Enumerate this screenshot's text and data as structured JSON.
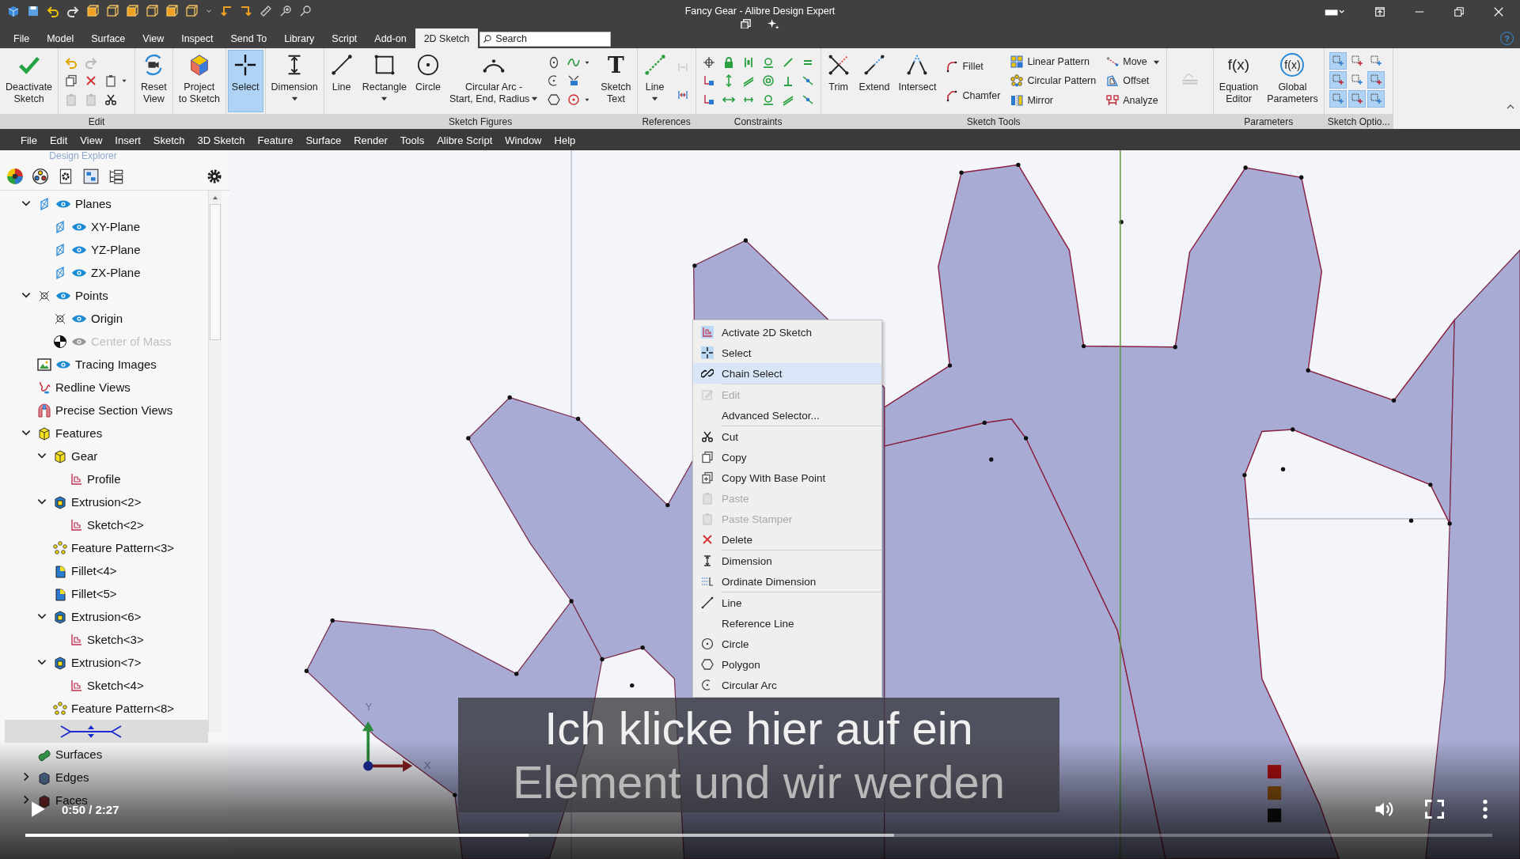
{
  "window": {
    "title": "Fancy Gear - Alibre Design Expert",
    "help": "?"
  },
  "ribbon_tabs": [
    {
      "label": "File",
      "selected": false
    },
    {
      "label": "Model",
      "selected": false
    },
    {
      "label": "Surface",
      "selected": false
    },
    {
      "label": "View",
      "selected": false
    },
    {
      "label": "Inspect",
      "selected": false
    },
    {
      "label": "Send To",
      "selected": false
    },
    {
      "label": "Library",
      "selected": false
    },
    {
      "label": "Script",
      "selected": false
    },
    {
      "label": "Add-on",
      "selected": false
    },
    {
      "label": "2D Sketch",
      "selected": true
    }
  ],
  "search": {
    "placeholder": "Search"
  },
  "ribbon": {
    "groups": [
      {
        "items": [
          {
            "kind": "large",
            "label": "Deactivate\nSketch",
            "selected": false
          }
        ]
      },
      {
        "label": "Edit",
        "items": [
          {
            "kind": "grid"
          }
        ]
      },
      {
        "items": [
          {
            "kind": "large",
            "label": "Reset\nView",
            "selected": false
          }
        ]
      },
      {
        "items": [
          {
            "kind": "large",
            "label": "Project\nto Sketch",
            "selected": false
          }
        ]
      },
      {
        "items": [
          {
            "kind": "large",
            "label": "Select",
            "selected": true
          }
        ]
      },
      {
        "items": [
          {
            "kind": "large",
            "label": "Dimension",
            "selected": false,
            "dropdown": true
          }
        ]
      },
      {
        "label": "Sketch Figures",
        "items": [
          {
            "kind": "large",
            "label": "Line",
            "selected": false
          },
          {
            "kind": "large",
            "label": "Rectangle",
            "selected": false,
            "dropdown": true
          },
          {
            "kind": "large",
            "label": "Circle",
            "selected": false
          },
          {
            "kind": "split",
            "label": "Circular Arc -\nStart, End, Radius",
            "selected": false,
            "dropdown": true
          },
          {
            "kind": "grid"
          },
          {
            "kind": "large",
            "label": "Sketch\nText",
            "icon_text": "T",
            "selected": false
          }
        ]
      },
      {
        "label": "References",
        "items": [
          {
            "kind": "large",
            "label": "Line",
            "selected": false,
            "dropdown": true
          },
          {
            "kind": "grid"
          }
        ]
      },
      {
        "label": "Constraints",
        "items": [
          {
            "kind": "grid"
          }
        ]
      },
      {
        "label": "Sketch Tools",
        "items": [
          {
            "kind": "large",
            "label": "Trim",
            "selected": false
          },
          {
            "kind": "large",
            "label": "Extend",
            "selected": false
          },
          {
            "kind": "large",
            "label": "Intersect",
            "selected": false
          },
          {
            "kind": "list",
            "rows": [
              {
                "label": "Fillet"
              },
              {
                "label": "Chamfer"
              }
            ]
          },
          {
            "kind": "list",
            "rows": [
              {
                "label": "Linear Pattern"
              },
              {
                "label": "Circular Pattern"
              },
              {
                "label": "Mirror"
              }
            ]
          },
          {
            "kind": "list",
            "rows": [
              {
                "label": "Move",
                "dropdown": true
              },
              {
                "label": "Offset"
              },
              {
                "label": "Analyze"
              }
            ]
          }
        ]
      },
      {
        "items": [
          {
            "kind": "icon"
          }
        ]
      },
      {
        "label": "Parameters",
        "items": [
          {
            "kind": "large",
            "label": "Equation\nEditor",
            "icon_text": "f(x)",
            "selected": false
          },
          {
            "kind": "large",
            "label": "Global\nParameters",
            "icon_text": "f(x)",
            "circled": true,
            "selected": false
          }
        ]
      },
      {
        "label": "Sketch Optio...",
        "items": [
          {
            "kind": "toggles",
            "toggles": [
              {
                "on": true
              },
              {
                "on": false
              },
              {
                "on": false
              },
              {
                "on": true
              },
              {
                "on": false
              },
              {
                "on": true
              },
              {
                "on": true
              },
              {
                "on": true
              },
              {
                "on": true
              }
            ]
          }
        ]
      }
    ]
  },
  "menu_bar": [
    "File",
    "Edit",
    "View",
    "Insert",
    "Sketch",
    "3D Sketch",
    "Feature",
    "Surface",
    "Render",
    "Tools",
    "Alibre Script",
    "Window",
    "Help"
  ],
  "explorer": {
    "title": "Design Explorer",
    "tree": [
      {
        "label": "Planes",
        "kind": "plane",
        "visible": true,
        "expanded": true,
        "selected": false,
        "children": [
          {
            "label": "XY-Plane",
            "kind": "plane",
            "visible": true,
            "selected": false
          },
          {
            "label": "YZ-Plane",
            "kind": "plane",
            "visible": true,
            "selected": false
          },
          {
            "label": "ZX-Plane",
            "kind": "plane",
            "visible": true,
            "selected": false
          }
        ]
      },
      {
        "label": "Points",
        "kind": "points",
        "visible": true,
        "expanded": true,
        "selected": false,
        "children": [
          {
            "label": "Origin",
            "kind": "points",
            "visible": true,
            "selected": false
          },
          {
            "label": "Center of Mass",
            "kind": "mass",
            "visible": true,
            "disabled": true,
            "selected": false
          }
        ]
      },
      {
        "label": "Tracing Images",
        "kind": "image",
        "visible": true,
        "selected": false
      },
      {
        "label": "Redline Views",
        "kind": "redline",
        "selected": false
      },
      {
        "label": "Precise Section Views",
        "kind": "section",
        "selected": false
      },
      {
        "label": "Features",
        "kind": "feature",
        "expanded": true,
        "selected": false,
        "children": [
          {
            "label": "Gear",
            "kind": "feature",
            "expanded": true,
            "selected": false,
            "children": [
              {
                "label": "Profile",
                "kind": "sketch",
                "selected": false
              }
            ]
          },
          {
            "label": "Extrusion<2>",
            "kind": "extrusion",
            "expanded": true,
            "selected": false,
            "children": [
              {
                "label": "Sketch<2>",
                "kind": "sketch",
                "selected": false
              }
            ]
          },
          {
            "label": "Feature Pattern<3>",
            "kind": "pattern",
            "selected": false
          },
          {
            "label": "Fillet<4>",
            "kind": "fillet",
            "selected": false
          },
          {
            "label": "Fillet<5>",
            "kind": "fillet",
            "selected": false
          },
          {
            "label": "Extrusion<6>",
            "kind": "extrusion",
            "expanded": true,
            "selected": false,
            "children": [
              {
                "label": "Sketch<3>",
                "kind": "sketch",
                "selected": false
              }
            ]
          },
          {
            "label": "Extrusion<7>",
            "kind": "extrusion",
            "expanded": true,
            "selected": false,
            "children": [
              {
                "label": "Sketch<4>",
                "kind": "sketch",
                "selected": false
              }
            ]
          },
          {
            "label": "Feature Pattern<8>",
            "kind": "pattern",
            "selected": false
          },
          {
            "kind": "symbol",
            "selected": true
          }
        ]
      },
      {
        "label": "Surfaces",
        "kind": "surfaces",
        "selected": false
      },
      {
        "label": "Edges",
        "kind": "edges",
        "expanded": false,
        "selected": false
      },
      {
        "label": "Faces",
        "kind": "faces",
        "expanded": false,
        "selected": false
      }
    ]
  },
  "viewport": {
    "axes": {
      "x_label": "X",
      "y_label": "Y"
    }
  },
  "context_menu": {
    "items": [
      {
        "label": "Activate 2D Sketch",
        "kind": "sketch",
        "disabled": false,
        "selected": false,
        "separator": false
      },
      {
        "label": "Select",
        "kind": "select",
        "disabled": false,
        "selected": false,
        "separator": false
      },
      {
        "label": "Chain Select",
        "kind": "chain",
        "disabled": false,
        "selected": true,
        "separator": false
      },
      {
        "label": "Edit",
        "kind": "edit",
        "disabled": true,
        "selected": false,
        "separator": true
      },
      {
        "label": "Advanced Selector...",
        "kind": "none",
        "disabled": false,
        "selected": false,
        "separator": false
      },
      {
        "label": "Cut",
        "kind": "cut",
        "disabled": false,
        "selected": false,
        "separator": true
      },
      {
        "label": "Copy",
        "kind": "copy",
        "disabled": false,
        "selected": false,
        "separator": false
      },
      {
        "label": "Copy With Base Point",
        "kind": "copy_base",
        "disabled": false,
        "selected": false,
        "separator": false
      },
      {
        "label": "Paste",
        "kind": "paste",
        "disabled": true,
        "selected": false,
        "separator": false
      },
      {
        "label": "Paste Stamper",
        "kind": "paste",
        "disabled": true,
        "selected": false,
        "separator": false
      },
      {
        "label": "Delete",
        "kind": "delete",
        "disabled": false,
        "selected": false,
        "separator": false
      },
      {
        "label": "Dimension",
        "kind": "dimension",
        "disabled": false,
        "selected": false,
        "separator": true
      },
      {
        "label": "Ordinate Dimension",
        "kind": "ordinate",
        "disabled": false,
        "selected": false,
        "separator": false
      },
      {
        "label": "Line",
        "kind": "line",
        "disabled": false,
        "selected": false,
        "separator": true
      },
      {
        "label": "Reference Line",
        "kind": "none",
        "disabled": false,
        "selected": false,
        "separator": false
      },
      {
        "label": "Circle",
        "kind": "circle",
        "disabled": false,
        "selected": false,
        "separator": false
      },
      {
        "label": "Polygon",
        "kind": "polygon",
        "disabled": false,
        "selected": false,
        "separator": false
      },
      {
        "label": "Circular Arc",
        "kind": "arc",
        "disabled": false,
        "selected": false,
        "separator": false
      }
    ]
  },
  "video": {
    "subtitles": [
      "Ich klicke hier auf ein",
      "Element und wir werden"
    ],
    "time": "0:50 / 2:27",
    "progress": {
      "level": 0.343,
      "buffered": {
        "level": 0.592
      }
    }
  }
}
